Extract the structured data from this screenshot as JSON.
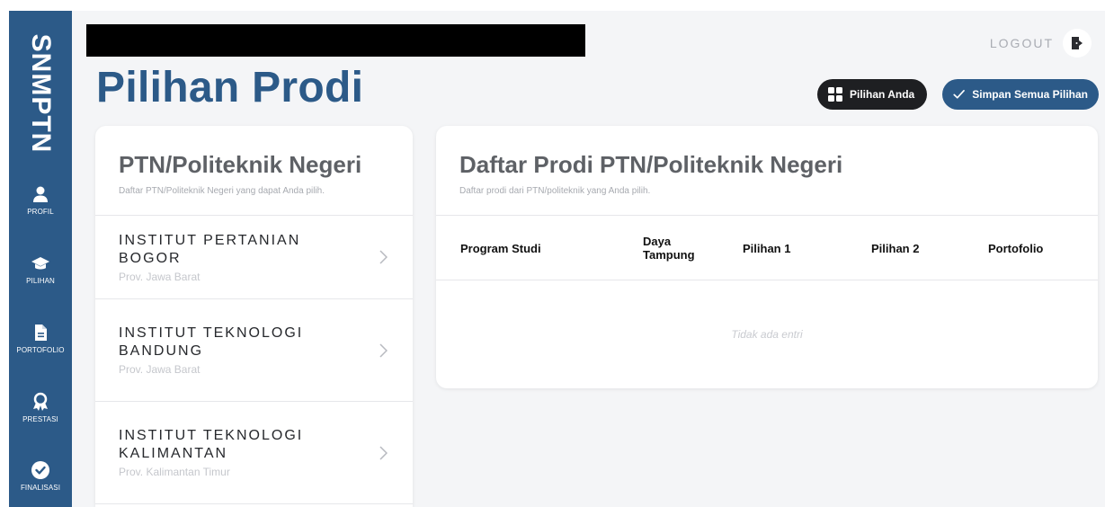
{
  "sidebar": {
    "brand": "SNMPTN",
    "items": [
      {
        "label": "PROFIL",
        "icon": "person-icon"
      },
      {
        "label": "PILIHAN",
        "icon": "graduation-cap-icon"
      },
      {
        "label": "PORTOFOLIO",
        "icon": "document-icon"
      },
      {
        "label": "PRESTASI",
        "icon": "award-icon"
      },
      {
        "label": "FINALISASI",
        "icon": "check-circle-icon"
      }
    ]
  },
  "header": {
    "title": "Pilihan Prodi",
    "logout": "LOGOUT",
    "pilihan_anda": "Pilihan Anda",
    "simpan": "Simpan Semua Pilihan"
  },
  "left_panel": {
    "title": "PTN/Politeknik Negeri",
    "subtitle": "Daftar PTN/Politeknik Negeri yang dapat Anda pilih.",
    "items": [
      {
        "name": "INSTITUT PERTANIAN BOGOR",
        "province": "Prov. Jawa Barat"
      },
      {
        "name": "INSTITUT TEKNOLOGI BANDUNG",
        "province": "Prov. Jawa Barat"
      },
      {
        "name": "INSTITUT TEKNOLOGI KALIMANTAN",
        "province": "Prov. Kalimantan Timur"
      }
    ]
  },
  "right_panel": {
    "title": "Daftar Prodi PTN/Politeknik Negeri",
    "subtitle": "Daftar prodi dari PTN/politeknik yang Anda pilih.",
    "columns": [
      "Program Studi",
      "Daya Tampung",
      "Pilihan 1",
      "Pilihan 2",
      "Portofolio"
    ],
    "empty_text": "Tidak ada entri"
  },
  "colors": {
    "brand_blue": "#2c5a88",
    "dark_button": "#1e1f22",
    "background": "#f4f5f7"
  }
}
